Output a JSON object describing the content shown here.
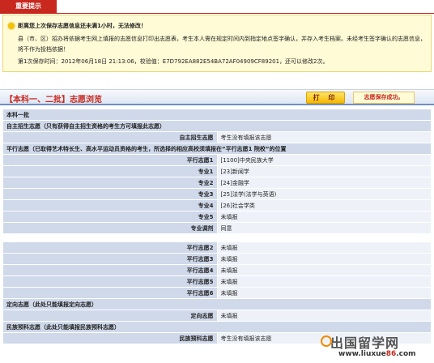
{
  "notice": {
    "tab": "重要提示",
    "line1": "距离您上次保存志愿信息还未满1小时，无法修改！",
    "line2": "县（市、区）招办将依据考生网上填报的志愿信息打印出志愿表，考生本人需在规定时间内到指定地点签字确认，并存入考生档案。未经考生签字确认的志愿信息，将不作为投档依据！",
    "line4_prefix": "第1次保存时间：",
    "save_time": "2012年06月18日 21:13:06",
    "check_label": "，校验值：",
    "check_value": "E7D792EA882E54BA72AF04909CF89201",
    "line4_suffix": "，还可以修改2次。"
  },
  "title": {
    "text": "【本科一、二批】志愿浏览",
    "print": "打 印",
    "saved": "志愿保存成功。"
  },
  "table": {
    "batch": "本科一批",
    "autonomy_header": "自主招生志愿（只有获得自主招生资格的考生方可填报此志愿）",
    "autonomy_label": "自主招生志愿",
    "autonomy_value": "考生没有填报该志愿",
    "parallel_header": "平行志愿（已取得艺术特长生、高水平运动员资格的考生，所选择的相应高校须填报在“平行志愿1 院校”的位置",
    "p1_label": "平行志愿1",
    "p1_value": "[1100]中央民族大学",
    "m1_label": "专业1",
    "m1_value": "[23]新闻学",
    "m2_label": "专业2",
    "m2_value": "[24]金融学",
    "m3_label": "专业3",
    "m3_value": "[25]法学(法学与英语)",
    "m4_label": "专业4",
    "m4_value": "[26]社会学类",
    "m5_label": "专业5",
    "m5_value": "未填报",
    "adjust_label": "专业调剂",
    "adjust_value": "同意",
    "p2_label": "平行志愿2",
    "p2_value": "未填报",
    "p3_label": "平行志愿3",
    "p3_value": "未填报",
    "p4_label": "平行志愿4",
    "p4_value": "未填报",
    "p5_label": "平行志愿5",
    "p5_value": "未填报",
    "p6_label": "平行志愿6",
    "p6_value": "未填报",
    "directed_header": "定向志愿（此处只能填报定向志愿）",
    "directed_label": "定向志愿",
    "directed_value": "未填报",
    "minority_header": "民族预科志愿（此处只能填报民族预科志愿）",
    "minority_label": "民族预科志愿",
    "minority_value": "考生没有填报该志愿"
  },
  "watermark": {
    "main": "出国留学网",
    "url_a": "www.liuxue",
    "url_b": "86",
    "url_c": ".com"
  }
}
